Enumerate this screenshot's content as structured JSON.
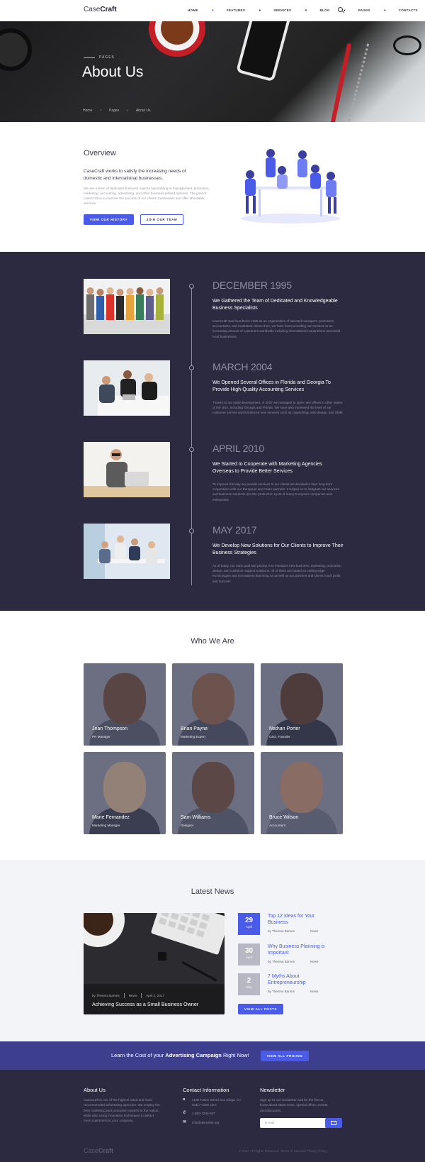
{
  "brand": {
    "logo_light": "Case",
    "logo_bold": "Craft"
  },
  "nav": {
    "items": [
      "HOME",
      "FEATURES",
      "SERVICES",
      "BLOG",
      "PAGES",
      "CONTACTS"
    ],
    "active": "HOME"
  },
  "hero": {
    "kicker": "PAGES",
    "title": "About Us",
    "breadcrumb": [
      "Home",
      "Pages",
      "About Us"
    ]
  },
  "overview": {
    "title": "Overview",
    "lead": "CaseCraft works to satisfy the increasing needs of domestic and international businesses.",
    "body": "We are a team of dedicated business experts specializing in management, promotion, marketing, accounting, advertising, and other business-related spheres. The goal of CaseCraft is to improve the success of our clients' businesses and offer affordable services.",
    "btn_history": "VIEW OUR HISTORY",
    "btn_team": "JOIN OUR TEAM"
  },
  "timeline": [
    {
      "date": "DECEMBER 1995",
      "heading": "We Gathered the Team of Dedicated and Knowledgeable Business Specialists",
      "body": "CaseCraft was founded in 1995 as an organization of talented managers, promoters, accountants, and marketers. Since then, we have been providing our services to an increasing amount of customers worldwide including international corporations and small local businesses."
    },
    {
      "date": "MARCH 2004",
      "heading": "We Opened Several Offices in Florida and Georgia To Provide High-Quality Accounting Services",
      "body": "Thanks to our rapid development, in 2007 we managed to open new offices in other states of the USA, including Georgia and Florida. We have also increased the level of our customer service and introduced new services such as copywriting, web design, and SMM."
    },
    {
      "date": "APRIL 2010",
      "heading": "We Started to Cooperate with Marketing Agencies Overseas to Provide Better Services",
      "body": "To improve the way we provide services to our clients we decided to start long-term cooperation with our European and Asian partners. It helped us to integrate our services and business solutions into the production cycle of many European companies and enterprises."
    },
    {
      "date": "MAY 2017",
      "heading": "We Develop New Solutions for Our Clients to Improve Their Business Strategies",
      "body": "As of today, our main goal and priority is to introduce new business, marketing, promotion, design, and customer support solutions. All of them are based on cutting-edge technologies and innovations that bring us as well as our partners and clients much profit and success."
    }
  ],
  "team": {
    "title": "Who We Are",
    "members": [
      {
        "name": "Jean Thompson",
        "role": "PR Manager"
      },
      {
        "name": "Brian Payne",
        "role": "Marketing Expert"
      },
      {
        "name": "Nathan Porter",
        "role": "CEO, Founder"
      },
      {
        "name": "Marie Fernandez",
        "role": "Marketing Manager"
      },
      {
        "name": "Sam Williams",
        "role": "Designer"
      },
      {
        "name": "Bruce Wilson",
        "role": "Accountant"
      }
    ]
  },
  "news": {
    "title": "Latest News",
    "featured": {
      "author": "by Theresa Barnes",
      "category": "News",
      "date": "April 2, 2017",
      "title": "Achieving Success as a Small Business Owner"
    },
    "items": [
      {
        "day": "29",
        "month": "April",
        "title": "Top 12 Ideas for Your Business",
        "author": "by Theresa Barnes",
        "category": "News"
      },
      {
        "day": "30",
        "month": "April",
        "title": "Why Business Planning is Important",
        "author": "by Theresa Barnes",
        "category": "News"
      },
      {
        "day": "2",
        "month": "May",
        "title": "7 Myths About Entrepreneurship",
        "author": "by Theresa Barnes",
        "category": "News"
      }
    ],
    "btn_all": "VIEW ALL POSTS"
  },
  "cta": {
    "pre": "Learn the Cost of your ",
    "bold": "Advertising Campaign",
    "post": " Right Now!",
    "btn": "VIEW ALL PRICING"
  },
  "footer": {
    "about_title": "About Us",
    "about_body": "CaseCraft is one of the highest rated and most recommended advertising agencies. We employ the best marketing and promotion experts in the nation, while also using innovative techniques to attract more customers to your company.",
    "contact_title": "Contact Information",
    "address": "2130 Fulton Street San Diego, CA 94117-1080 USA",
    "phone": "1-800-1234-567",
    "email": "info@demolink.org",
    "newsletter_title": "Newsletter",
    "newsletter_body": "Sign up to our newsletter and be the first to know about latest news, special offers, events, and discounts.",
    "email_placeholder": "E-mail",
    "copyright": "© 2017 All Rights Reserved. Terms of Use and Privacy Policy"
  },
  "colors": {
    "accent": "#4a5be8",
    "dark": "#2b2a40",
    "cta": "#3e3e8e"
  }
}
